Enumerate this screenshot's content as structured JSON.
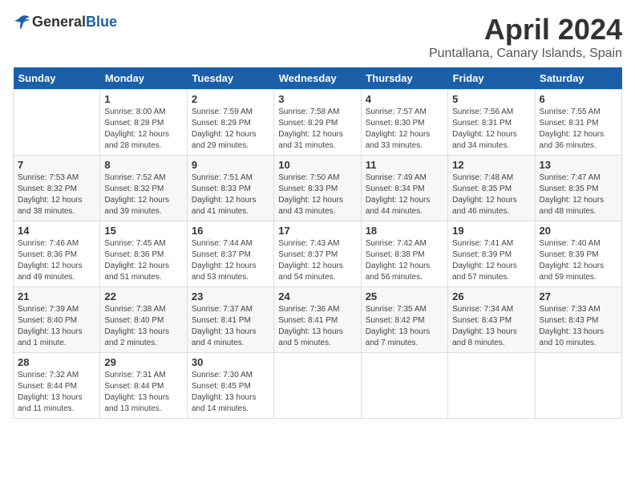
{
  "header": {
    "logo_general": "General",
    "logo_blue": "Blue",
    "title": "April 2024",
    "location": "Puntallana, Canary Islands, Spain"
  },
  "calendar": {
    "weekdays": [
      "Sunday",
      "Monday",
      "Tuesday",
      "Wednesday",
      "Thursday",
      "Friday",
      "Saturday"
    ],
    "weeks": [
      [
        {
          "day": "",
          "info": ""
        },
        {
          "day": "1",
          "info": "Sunrise: 8:00 AM\nSunset: 8:28 PM\nDaylight: 12 hours\nand 28 minutes."
        },
        {
          "day": "2",
          "info": "Sunrise: 7:59 AM\nSunset: 8:29 PM\nDaylight: 12 hours\nand 29 minutes."
        },
        {
          "day": "3",
          "info": "Sunrise: 7:58 AM\nSunset: 8:29 PM\nDaylight: 12 hours\nand 31 minutes."
        },
        {
          "day": "4",
          "info": "Sunrise: 7:57 AM\nSunset: 8:30 PM\nDaylight: 12 hours\nand 33 minutes."
        },
        {
          "day": "5",
          "info": "Sunrise: 7:56 AM\nSunset: 8:31 PM\nDaylight: 12 hours\nand 34 minutes."
        },
        {
          "day": "6",
          "info": "Sunrise: 7:55 AM\nSunset: 8:31 PM\nDaylight: 12 hours\nand 36 minutes."
        }
      ],
      [
        {
          "day": "7",
          "info": "Sunrise: 7:53 AM\nSunset: 8:32 PM\nDaylight: 12 hours\nand 38 minutes."
        },
        {
          "day": "8",
          "info": "Sunrise: 7:52 AM\nSunset: 8:32 PM\nDaylight: 12 hours\nand 39 minutes."
        },
        {
          "day": "9",
          "info": "Sunrise: 7:51 AM\nSunset: 8:33 PM\nDaylight: 12 hours\nand 41 minutes."
        },
        {
          "day": "10",
          "info": "Sunrise: 7:50 AM\nSunset: 8:33 PM\nDaylight: 12 hours\nand 43 minutes."
        },
        {
          "day": "11",
          "info": "Sunrise: 7:49 AM\nSunset: 8:34 PM\nDaylight: 12 hours\nand 44 minutes."
        },
        {
          "day": "12",
          "info": "Sunrise: 7:48 AM\nSunset: 8:35 PM\nDaylight: 12 hours\nand 46 minutes."
        },
        {
          "day": "13",
          "info": "Sunrise: 7:47 AM\nSunset: 8:35 PM\nDaylight: 12 hours\nand 48 minutes."
        }
      ],
      [
        {
          "day": "14",
          "info": "Sunrise: 7:46 AM\nSunset: 8:36 PM\nDaylight: 12 hours\nand 49 minutes."
        },
        {
          "day": "15",
          "info": "Sunrise: 7:45 AM\nSunset: 8:36 PM\nDaylight: 12 hours\nand 51 minutes."
        },
        {
          "day": "16",
          "info": "Sunrise: 7:44 AM\nSunset: 8:37 PM\nDaylight: 12 hours\nand 53 minutes."
        },
        {
          "day": "17",
          "info": "Sunrise: 7:43 AM\nSunset: 8:37 PM\nDaylight: 12 hours\nand 54 minutes."
        },
        {
          "day": "18",
          "info": "Sunrise: 7:42 AM\nSunset: 8:38 PM\nDaylight: 12 hours\nand 56 minutes."
        },
        {
          "day": "19",
          "info": "Sunrise: 7:41 AM\nSunset: 8:39 PM\nDaylight: 12 hours\nand 57 minutes."
        },
        {
          "day": "20",
          "info": "Sunrise: 7:40 AM\nSunset: 8:39 PM\nDaylight: 12 hours\nand 59 minutes."
        }
      ],
      [
        {
          "day": "21",
          "info": "Sunrise: 7:39 AM\nSunset: 8:40 PM\nDaylight: 13 hours\nand 1 minute."
        },
        {
          "day": "22",
          "info": "Sunrise: 7:38 AM\nSunset: 8:40 PM\nDaylight: 13 hours\nand 2 minutes."
        },
        {
          "day": "23",
          "info": "Sunrise: 7:37 AM\nSunset: 8:41 PM\nDaylight: 13 hours\nand 4 minutes."
        },
        {
          "day": "24",
          "info": "Sunrise: 7:36 AM\nSunset: 8:41 PM\nDaylight: 13 hours\nand 5 minutes."
        },
        {
          "day": "25",
          "info": "Sunrise: 7:35 AM\nSunset: 8:42 PM\nDaylight: 13 hours\nand 7 minutes."
        },
        {
          "day": "26",
          "info": "Sunrise: 7:34 AM\nSunset: 8:43 PM\nDaylight: 13 hours\nand 8 minutes."
        },
        {
          "day": "27",
          "info": "Sunrise: 7:33 AM\nSunset: 8:43 PM\nDaylight: 13 hours\nand 10 minutes."
        }
      ],
      [
        {
          "day": "28",
          "info": "Sunrise: 7:32 AM\nSunset: 8:44 PM\nDaylight: 13 hours\nand 11 minutes."
        },
        {
          "day": "29",
          "info": "Sunrise: 7:31 AM\nSunset: 8:44 PM\nDaylight: 13 hours\nand 13 minutes."
        },
        {
          "day": "30",
          "info": "Sunrise: 7:30 AM\nSunset: 8:45 PM\nDaylight: 13 hours\nand 14 minutes."
        },
        {
          "day": "",
          "info": ""
        },
        {
          "day": "",
          "info": ""
        },
        {
          "day": "",
          "info": ""
        },
        {
          "day": "",
          "info": ""
        }
      ]
    ]
  }
}
